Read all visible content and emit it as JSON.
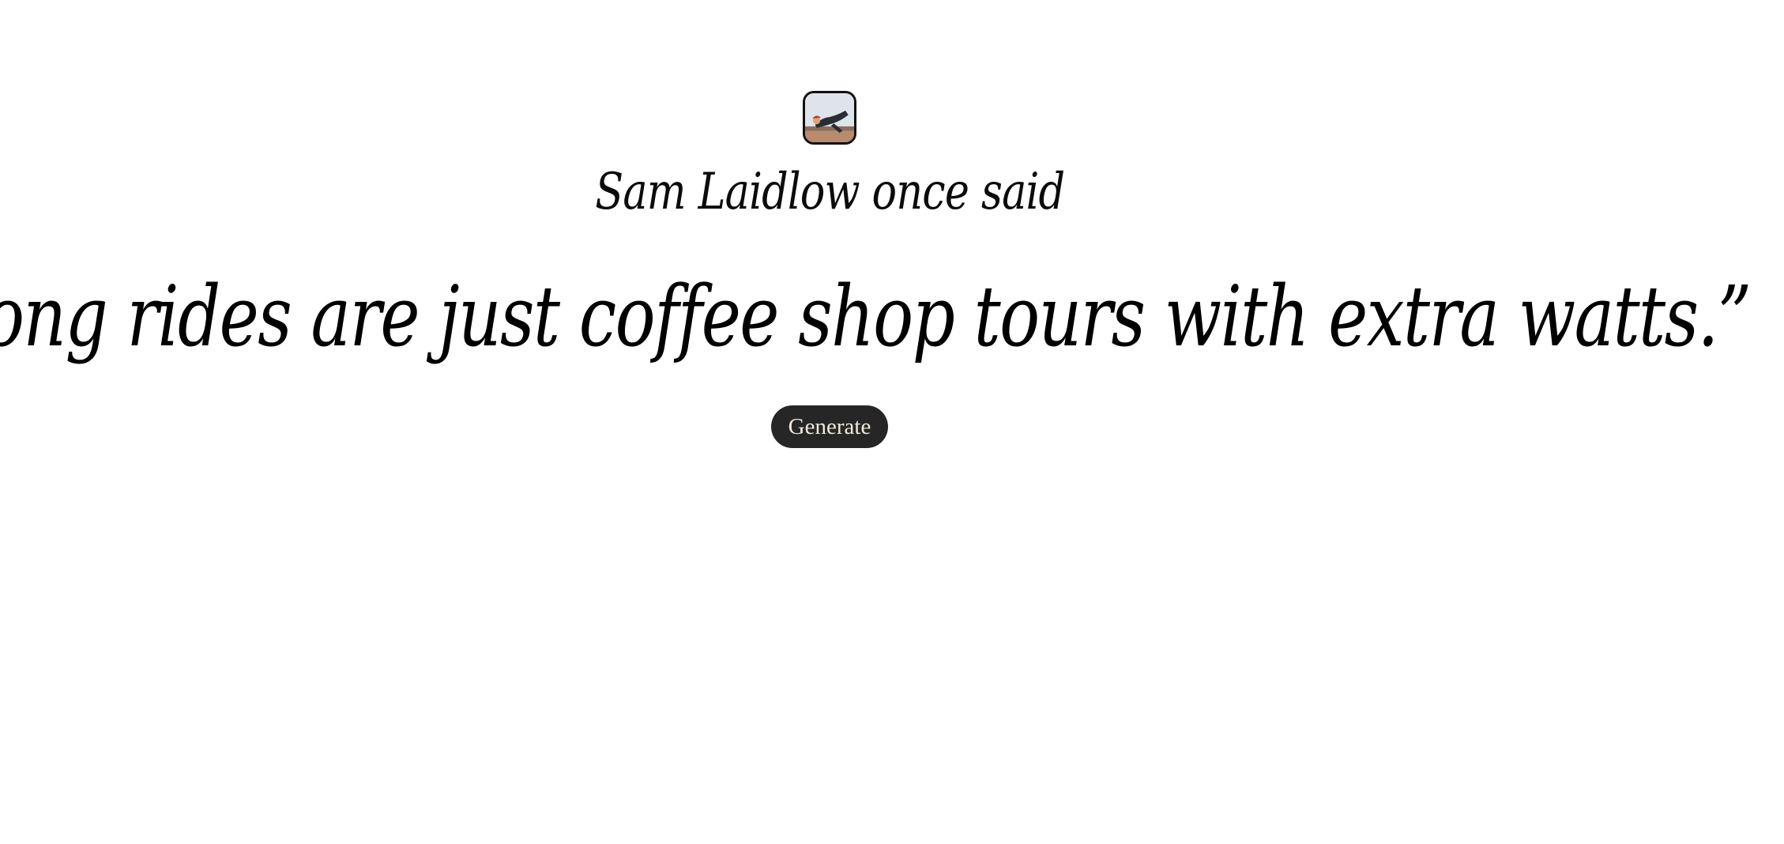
{
  "author": {
    "avatar_icon": "cyclist-photo-avatar",
    "attribution": "Sam Laidlow once said"
  },
  "quote": {
    "text": "“Long rides are just coffee shop tours with extra watts.”"
  },
  "actions": {
    "generate_label": "Generate",
    "button_bg": "#262626",
    "button_fg": "#f3e9da"
  }
}
